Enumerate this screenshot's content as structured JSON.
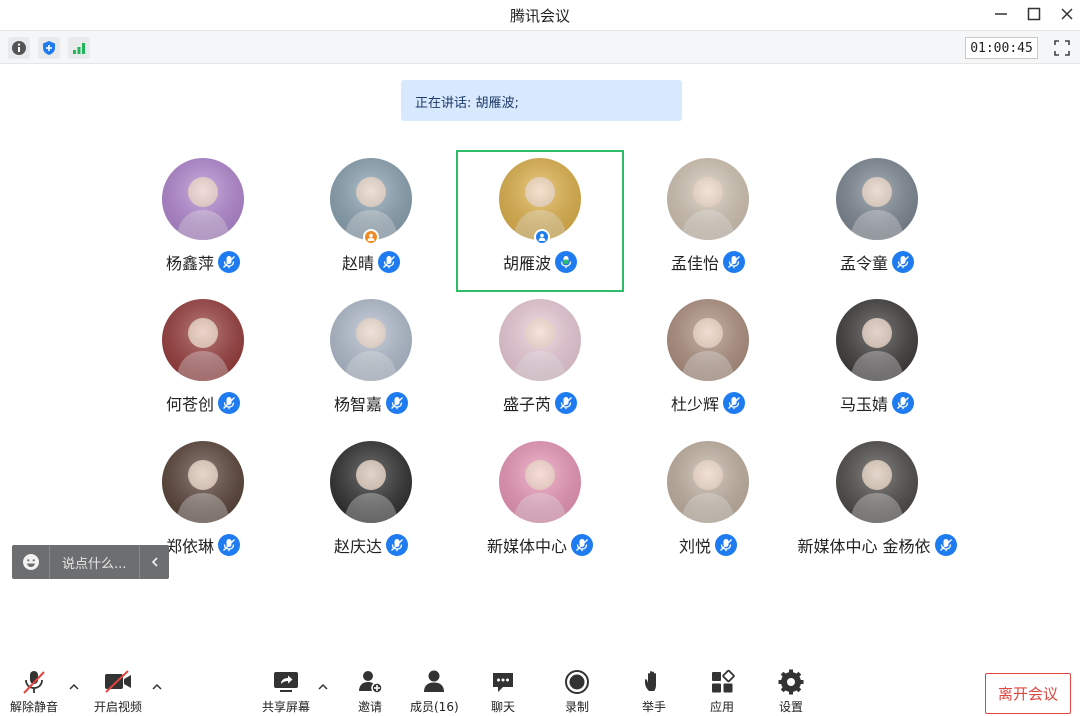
{
  "app": {
    "title": "腾讯会议"
  },
  "infobar": {
    "timer": "01:00:45"
  },
  "speaking": {
    "text": "正在讲话: 胡雁波;"
  },
  "participants": [
    {
      "name": "杨鑫萍",
      "avatar_color": "#b88ad8"
    },
    {
      "name": "赵晴",
      "avatar_color": "#8ea7b7",
      "badge": "host"
    },
    {
      "name": "胡雁波",
      "avatar_color": "#e8b84a",
      "badge": "cohost",
      "active": true
    },
    {
      "name": "孟佳怡",
      "avatar_color": "#d9cbb9"
    },
    {
      "name": "孟令童",
      "avatar_color": "#7f8a96"
    },
    {
      "name": "何苍创",
      "avatar_color": "#9c3b3b"
    },
    {
      "name": "杨智嘉",
      "avatar_color": "#b7c3d4"
    },
    {
      "name": "盛子芮",
      "avatar_color": "#f4d3e0"
    },
    {
      "name": "杜少辉",
      "avatar_color": "#b39483"
    },
    {
      "name": "马玉婧",
      "avatar_color": "#3e3a3a"
    },
    {
      "name": "郑依琳",
      "avatar_color": "#5a4338"
    },
    {
      "name": "赵庆达",
      "avatar_color": "#2d2d2d"
    },
    {
      "name": "新媒体中心",
      "avatar_color": "#f39bbd"
    },
    {
      "name": "刘悦",
      "avatar_color": "#c8b7a6"
    },
    {
      "name": "新媒体中心 金杨依",
      "avatar_color": "#4d4a47"
    }
  ],
  "chat": {
    "placeholder": "说点什么..."
  },
  "toolbar": {
    "mute_label": "解除静音",
    "video_label": "开启视频",
    "share_label": "共享屏幕",
    "invite_label": "邀请",
    "members_label": "成员(16)",
    "chat_label": "聊天",
    "record_label": "录制",
    "raise_hand_label": "举手",
    "apps_label": "应用",
    "settings_label": "设置",
    "leave_label": "离开会议"
  },
  "colors": {
    "accent": "#1e7bf0",
    "active_border": "#2fbd6a",
    "leave": "#e0463f",
    "speaking_bg": "#d8e8fd"
  }
}
